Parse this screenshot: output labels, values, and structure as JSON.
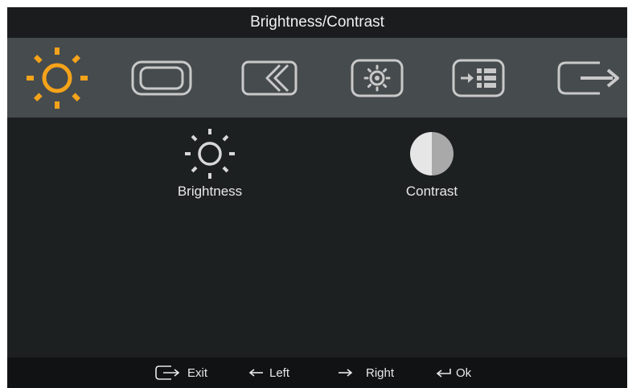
{
  "window": {
    "title": "Brightness/Contrast"
  },
  "colors": {
    "accent": "#f5a31a",
    "icon": "#c9c9c9",
    "panel": "#1d2021",
    "tabbar": "#464b4d"
  },
  "tabs": [
    {
      "icon": "sun-icon",
      "selected": true
    },
    {
      "icon": "screen-position-icon",
      "selected": false
    },
    {
      "icon": "image-setup-icon",
      "selected": false
    },
    {
      "icon": "image-properties-icon",
      "selected": false
    },
    {
      "icon": "options-menu-icon",
      "selected": false
    },
    {
      "icon": "exit-icon",
      "selected": false
    }
  ],
  "options": [
    {
      "label": "Brightness",
      "icon": "brightness-icon"
    },
    {
      "label": "Contrast",
      "icon": "contrast-icon"
    }
  ],
  "footer": {
    "exit": "Exit",
    "left": "Left",
    "right": "Right",
    "ok": "Ok"
  }
}
